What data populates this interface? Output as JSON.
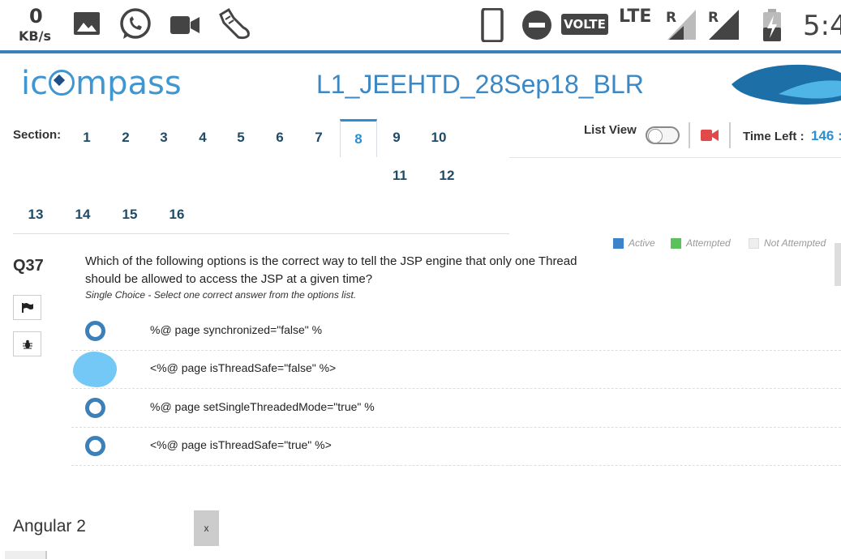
{
  "statusbar": {
    "speed_value": "0",
    "speed_unit": "KB/s",
    "volte_label": "VOLTE",
    "network_label": "LTE",
    "roaming_label_1": "R",
    "roaming_label_2": "R",
    "time": "5:4",
    "icons": [
      "image-icon",
      "whatsapp-icon",
      "video-camera-icon",
      "sneaker-icon",
      "phone-icon",
      "do-not-disturb-icon",
      "signal-icon",
      "battery-icon"
    ]
  },
  "header": {
    "logo_text_before": "ic",
    "logo_text_after": "mpass",
    "test_title": "L1_JEEHTD_28Sep18_BLR"
  },
  "sections": {
    "label": "Section:",
    "items": [
      "1",
      "2",
      "3",
      "4",
      "5",
      "6",
      "7",
      "8",
      "9",
      "10",
      "11",
      "12",
      "13",
      "14",
      "15",
      "16"
    ],
    "active": "8"
  },
  "controls": {
    "list_view_label": "List View",
    "list_view_on": false,
    "time_left_label": "Time Left :",
    "time_left_value": "146 :"
  },
  "legend": {
    "active": "Active",
    "attempted": "Attempted",
    "not_attempted": "Not Attempted",
    "colors": {
      "active": "#3d83c8",
      "attempted": "#5cc05c",
      "not_attempted": "#eeeeee"
    }
  },
  "question": {
    "number": "Q37",
    "text": "Which of the following options is the correct way to tell the JSP engine that only one Thread should be allowed to access the JSP at a given time?",
    "type": "Single Choice - Select one correct answer from the options list.",
    "options": [
      {
        "text": "%@ page synchronized=\"false\" %",
        "selected": false
      },
      {
        "text": "<%@ page isThreadSafe=\"false\" %>",
        "selected": true
      },
      {
        "text": "%@ page setSingleThreadedMode=\"true\" %",
        "selected": false
      },
      {
        "text": "<%@ page isThreadSafe=\"true\" %>",
        "selected": false
      }
    ]
  },
  "bottom": {
    "title": "Angular 2",
    "close_label": "x"
  },
  "colors": {
    "accent": "#2a90d0",
    "brand": "#3f96d0",
    "radio": "#3d7fb8",
    "selected_blob": "#74c8f5",
    "recording": "#e04a4a"
  }
}
